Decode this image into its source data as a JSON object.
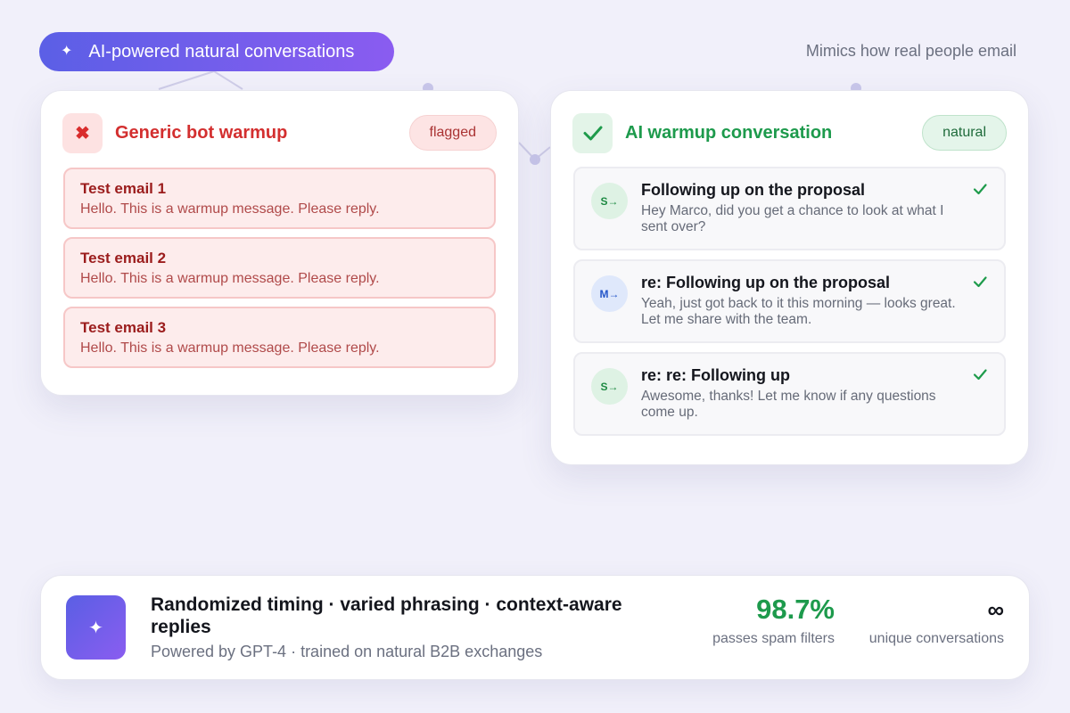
{
  "header": {
    "pill_label": "AI-powered natural conversations",
    "pill_icon": "sparkle-icon",
    "tagline": "Mimics how real people email"
  },
  "bot_card": {
    "title": "Generic bot warmup",
    "badge": "flagged",
    "icon": "x-icon",
    "accent": "#d32f2f",
    "items": [
      {
        "title": "Test email 1",
        "body": "Hello. This is a warmup message. Please reply."
      },
      {
        "title": "Test email 2",
        "body": "Hello. This is a warmup message. Please reply."
      },
      {
        "title": "Test email 3",
        "body": "Hello. This is a warmup message. Please reply."
      }
    ]
  },
  "ai_card": {
    "title": "AI warmup conversation",
    "badge": "natural",
    "icon": "check-icon",
    "accent": "#1d9a4c",
    "items": [
      {
        "avatar": "S→",
        "title": "Following up on the proposal",
        "body": "Hey Marco, did you get a chance to look at what I sent over?"
      },
      {
        "avatar": "M→",
        "title": "re: Following up on the proposal",
        "body": "Yeah, just got back to it this morning — looks great. Let me share with the team."
      },
      {
        "avatar": "S→",
        "title": "re: re: Following up",
        "body": "Awesome, thanks! Let me know if any questions come up."
      }
    ]
  },
  "bottom": {
    "title": "Randomized timing · varied phrasing · context-aware replies",
    "subtitle": "Powered by GPT-4 · trained on natural B2B exchanges",
    "icon": "sparkle-icon",
    "stats": [
      {
        "value": "98.7%",
        "label": "passes spam filters"
      },
      {
        "value": "∞",
        "label": "unique conversations"
      }
    ]
  }
}
